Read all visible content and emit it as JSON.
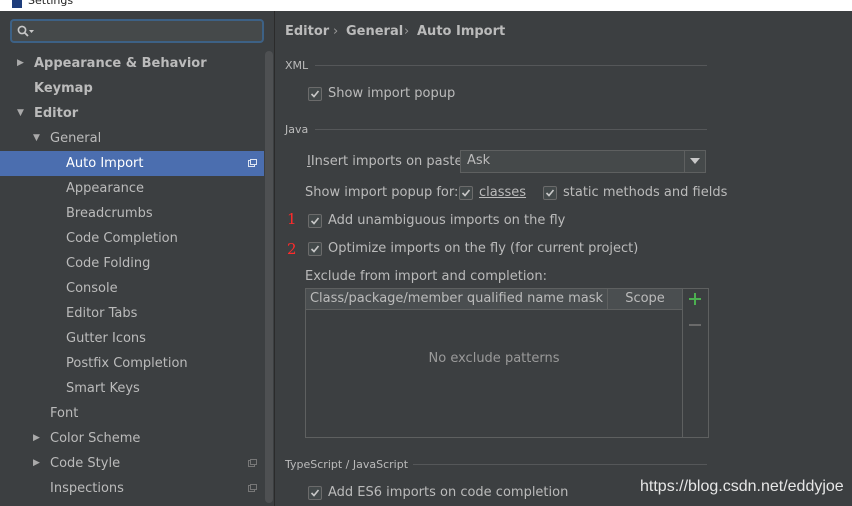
{
  "window": {
    "title": "Settings"
  },
  "search": {
    "placeholder": "",
    "value": ""
  },
  "sidebar": {
    "items": [
      {
        "label": "Appearance & Behavior",
        "arrow": "▶"
      },
      {
        "label": "Keymap"
      },
      {
        "label": "Editor",
        "arrow": "▼"
      },
      {
        "label": "General",
        "arrow": "▼"
      },
      {
        "label": "Auto Import"
      },
      {
        "label": "Appearance"
      },
      {
        "label": "Breadcrumbs"
      },
      {
        "label": "Code Completion"
      },
      {
        "label": "Code Folding"
      },
      {
        "label": "Console"
      },
      {
        "label": "Editor Tabs"
      },
      {
        "label": "Gutter Icons"
      },
      {
        "label": "Postfix Completion"
      },
      {
        "label": "Smart Keys"
      },
      {
        "label": "Font"
      },
      {
        "label": "Color Scheme",
        "arrow": "▶"
      },
      {
        "label": "Code Style",
        "arrow": "▶"
      },
      {
        "label": "Inspections"
      }
    ]
  },
  "breadcrumb": {
    "items": [
      "Editor",
      "General",
      "Auto Import"
    ],
    "separator": "›"
  },
  "xml": {
    "title": "XML",
    "show_import_popup": {
      "label": "Show import popup",
      "checked": true
    }
  },
  "java": {
    "title": "Java",
    "insert_imports_label": "Insert imports on paste:",
    "insert_imports_value": "Ask",
    "show_popup_for_label": "Show import popup for:",
    "classes": {
      "label": "classes",
      "checked": true
    },
    "static_methods": {
      "label": "static methods and fields",
      "checked": true
    },
    "add_unambiguous": {
      "label": "Add unambiguous imports on the fly",
      "checked": true,
      "marker": "1"
    },
    "optimize_imports": {
      "label": "Optimize imports on the fly (for current project)",
      "checked": true,
      "marker": "2"
    },
    "exclude_label": "Exclude from import and completion:",
    "table": {
      "columns": [
        "Class/package/member qualified name mask",
        "Scope"
      ],
      "empty_text": "No exclude patterns"
    }
  },
  "typescript": {
    "title": "TypeScript / JavaScript",
    "add_es6": {
      "label": "Add ES6 imports on code completion",
      "checked": true
    }
  },
  "watermark": "https://blog.csdn.net/eddyjoe",
  "colors": {
    "selection": "#4b6eaf",
    "background": "#3c3f41",
    "marker": "#ff2b2b",
    "add": "#4caf50"
  }
}
